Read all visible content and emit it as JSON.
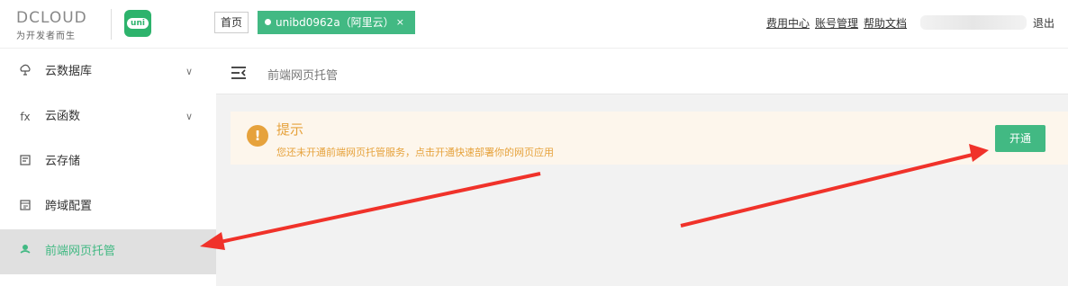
{
  "header": {
    "logo_text": "DCLOUD",
    "logo_sub": "为开发者而生",
    "uni_logo": "uni",
    "tabs": [
      {
        "label": "首页"
      },
      {
        "label": "unibd0962a（阿里云）",
        "close": "×"
      }
    ],
    "links": [
      "费用中心",
      "账号管理",
      "帮助文档"
    ],
    "logout": "退出"
  },
  "sidebar": {
    "items": [
      {
        "label": "云数据库",
        "icon": "cloud-database-icon",
        "expandable": true
      },
      {
        "label": "云函数",
        "icon": "fx-icon",
        "glyph": "fx",
        "expandable": true
      },
      {
        "label": "云存储",
        "icon": "storage-icon",
        "expandable": false
      },
      {
        "label": "跨域配置",
        "icon": "cross-domain-icon",
        "expandable": false
      },
      {
        "label": "前端网页托管",
        "icon": "hosting-icon",
        "expandable": false,
        "active": true
      }
    ]
  },
  "main": {
    "breadcrumb": "前端网页托管",
    "notice": {
      "title": "提示",
      "description": "您还未开通前端网页托管服务，点击开通快速部署你的网页应用",
      "button": "开通"
    }
  },
  "colors": {
    "accent": "#42b983",
    "warning": "#e6a23c",
    "notice_bg": "#fdf6ec",
    "annotation_arrow": "#f0322a"
  }
}
